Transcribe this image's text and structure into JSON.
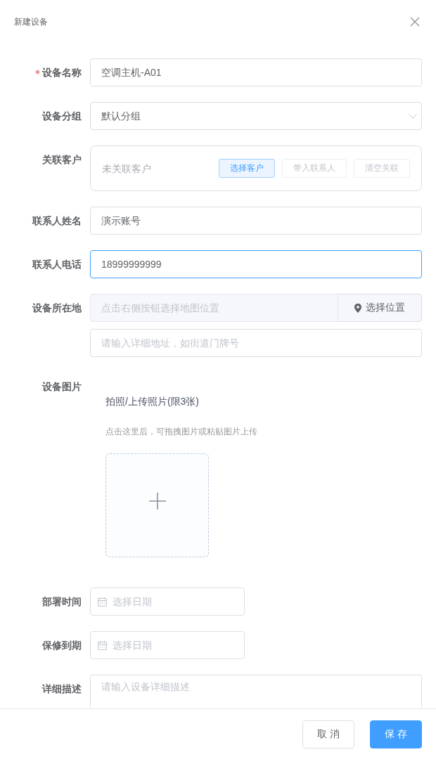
{
  "dialog": {
    "title": "新建设备"
  },
  "form": {
    "fields": [
      {
        "kind": "text",
        "label": "设备名称",
        "required": true,
        "value": "空调主机-A01",
        "focused": false
      },
      {
        "kind": "select",
        "label": "设备分组",
        "required": false,
        "value": "默认分组"
      },
      {
        "kind": "customer",
        "label": "关联客户",
        "required": false,
        "status": "未关联客户",
        "buttons": [
          {
            "label": "选择客户",
            "disabled": false
          },
          {
            "label": "带入联系人",
            "disabled": true
          },
          {
            "label": "清空关联",
            "disabled": true
          }
        ]
      },
      {
        "kind": "text",
        "label": "联系人姓名",
        "required": false,
        "value": "演示账号",
        "focused": false
      },
      {
        "kind": "text",
        "label": "联系人电话",
        "required": false,
        "value": "18999999999",
        "focused": true
      },
      {
        "kind": "location",
        "label": "设备所在地",
        "required": false,
        "map_placeholder": "点击右侧按钮选择地图位置",
        "button": "选择位置",
        "address_placeholder": "请输入详细地址，如街道门牌号"
      },
      {
        "kind": "upload",
        "label": "设备图片",
        "required": false,
        "title": "拍照/上传照片(限3张)",
        "hint": "点击这里后，可拖拽图片或粘贴图片上传"
      },
      {
        "kind": "date",
        "label": "部署时间",
        "required": false,
        "placeholder": "选择日期"
      },
      {
        "kind": "date",
        "label": "保修到期",
        "required": false,
        "placeholder": "选择日期"
      },
      {
        "kind": "textarea",
        "label": "详细描述",
        "required": false,
        "placeholder": "请输入设备详细描述"
      }
    ]
  },
  "footer": {
    "buttons": [
      {
        "label": "取 消",
        "kind": "default"
      },
      {
        "label": "保 存",
        "kind": "primary"
      }
    ]
  }
}
